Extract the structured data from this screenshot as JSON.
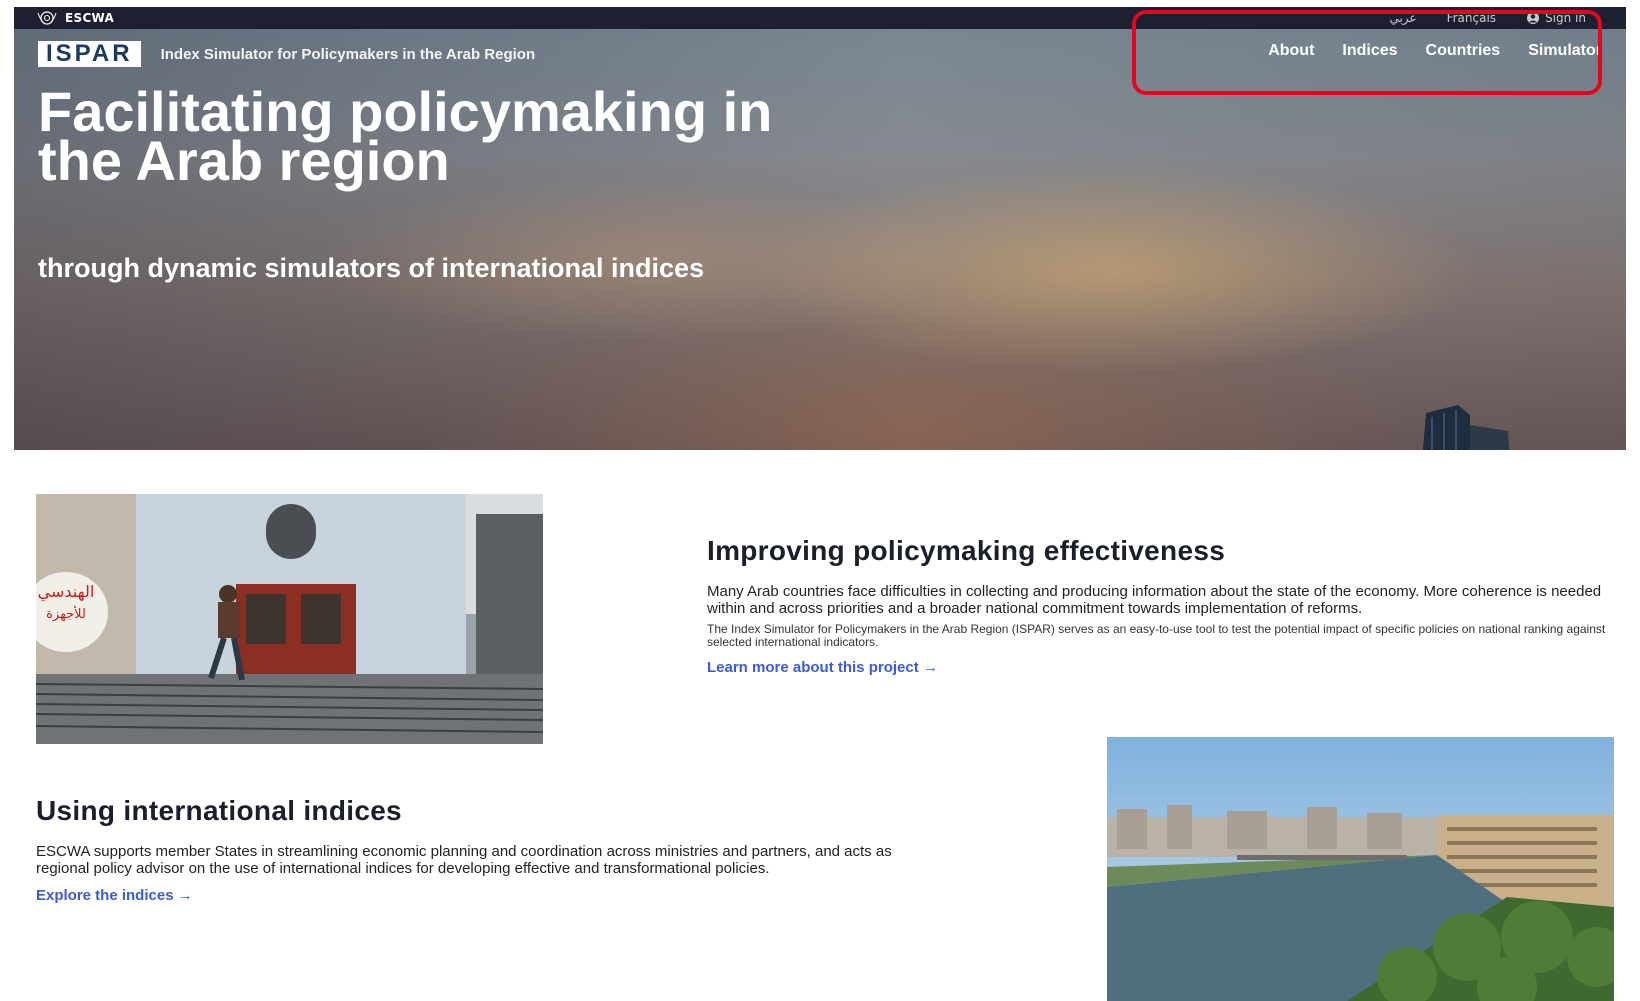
{
  "topbar": {
    "org_name": "ESCWA",
    "lang_arabic": "عربي",
    "lang_french": "Français",
    "signin_label": "Sign in"
  },
  "header": {
    "logo_text": "ISPAR",
    "tagline": "Index Simulator for Policymakers in the Arab Region",
    "nav": {
      "about": "About",
      "indices": "Indices",
      "countries": "Countries",
      "simulator": "Simulator"
    }
  },
  "hero": {
    "title": "Facilitating policymaking in the Arab region",
    "subtitle": "through dynamic simulators of international indices"
  },
  "section1": {
    "title": "Improving policymaking effectiveness",
    "body": "Many Arab countries face difficulties in collecting and producing information about the state of the economy. More coherence is needed within and across priorities and a broader national commitment towards implementation of reforms.",
    "small": "The Index Simulator for Policymakers in the Arab Region (ISPAR) serves as an easy-to-use tool to test the potential impact of specific policies on national ranking against selected international indicators.",
    "link": "Learn more about this project →"
  },
  "section2": {
    "title": "Using international indices",
    "body": "ESCWA supports member States in streamlining economic planning and coordination across ministries and partners, and acts as regional policy advisor on the use of international indices for developing effective and transformational policies.",
    "link": "Explore the indices →"
  },
  "images": {
    "street_sign_text": "الهندسي",
    "street_sign_small": "للأجهزة"
  },
  "colors": {
    "topbar_bg": "#1d2031",
    "link": "#3d5bd9",
    "highlight": "#e1071c"
  }
}
